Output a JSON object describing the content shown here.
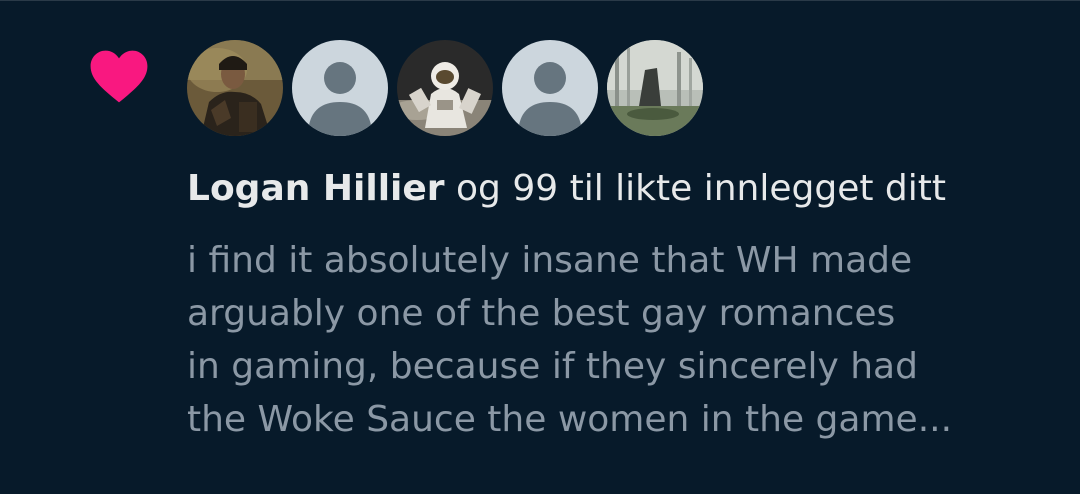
{
  "notification": {
    "type_icon": "heart-icon",
    "accent_color": "#f91880",
    "avatars": [
      {
        "icon": "avatar-photo-soldier"
      },
      {
        "icon": "avatar-default-person"
      },
      {
        "icon": "avatar-photo-astronaut"
      },
      {
        "icon": "avatar-default-person"
      },
      {
        "icon": "avatar-photo-landscape"
      }
    ],
    "actor_name": "Logan Hillier",
    "action_text": " og 99 til likte innlegget ditt",
    "post_excerpt": "i find it absolutely insane that WH made\narguably one of the best gay romances\nin gaming, because if they sincerely had\nthe Woke Sauce the women in the game..."
  }
}
